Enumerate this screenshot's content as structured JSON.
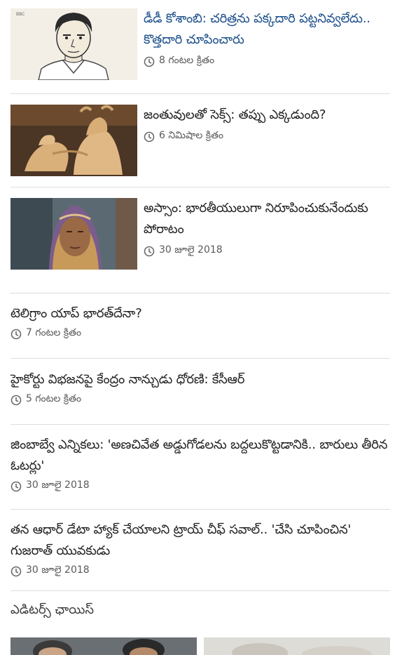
{
  "stories": [
    {
      "headline": "డీడీ కోశాంబి: చరిత్రను పక్కదారి పట్టనివ్వలేదు.. కొత్తదారి చూపించారు",
      "time": "8 గంటల క్రితం",
      "badge": "BBC"
    },
    {
      "headline": "జంతువులతో సెక్స్: తప్పు ఎక్కడుంది?",
      "time": "6 నిమిషాల క్రితం"
    },
    {
      "headline": "అస్సాం: భారతీయులుగా నిరూపించుకునేందుకు పోరాటం",
      "time": "30 జూలై 2018"
    },
    {
      "headline": "టెలిగ్రాం యాప్ భారత్‌దేనా?",
      "time": "7 గంటల క్రితం"
    },
    {
      "headline": "హైకోర్టు విభజనపై కేంద్రం నాన్చుడు ధోరణి: కేసీఆర్",
      "time": "5 గంటల క్రితం"
    },
    {
      "headline": "జింబాబ్వే ఎన్నికలు: 'అణచివేత అడ్డుగోడలను బద్దలుకొట్టడానికి.. బారులు తీరిన ఓటర్లు'",
      "time": "30 జూలై 2018"
    },
    {
      "headline": "తన ఆధార్ డేటా హ్యాక్ చేయాలని ట్రాయ్ చీఫ్ సవాల్.. 'చేసి చూపించిన' గుజరాత్ యువకుడు",
      "time": "30 జూలై 2018"
    }
  ],
  "editors_choice": {
    "title": "ఎడిటర్స్ ఛాయిస్"
  },
  "colors": {
    "featured_headline": "#1b4f8b",
    "headline": "#222222",
    "meta": "#5a5a5a",
    "divider": "#dddddd"
  },
  "icons": {
    "time": "clock-icon"
  }
}
